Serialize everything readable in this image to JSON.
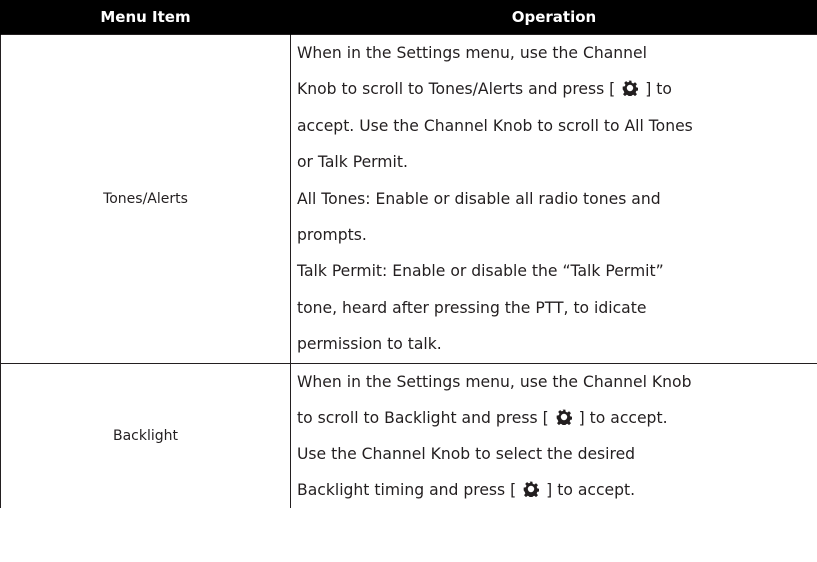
{
  "table": {
    "headers": [
      "Menu Item",
      "Operation"
    ],
    "rows": [
      {
        "item": "Tones/Alerts",
        "lines": [
          {
            "pre": "When in the Settings menu, use the Channel"
          },
          {
            "pre": "Knob to scroll to Tones/Alerts and press [",
            "icon": "gear-icon",
            "post": "] to"
          },
          {
            "pre": "accept. Use the Channel Knob to scroll to All Tones"
          },
          {
            "pre": "or Talk Permit."
          },
          {
            "pre": "All Tones: Enable or disable all radio tones and"
          },
          {
            "pre": "prompts."
          },
          {
            "pre": "Talk Permit: Enable or disable the “Talk Permit”"
          },
          {
            "pre": "tone, heard after pressing the PTT, to idicate"
          },
          {
            "pre": "permission to talk."
          }
        ]
      },
      {
        "item": "Backlight",
        "lines": [
          {
            "pre": "When in the Settings menu, use the Channel Knob"
          },
          {
            "pre": "to scroll to Backlight and press [",
            "icon": "gear-icon",
            "post": "] to accept."
          },
          {
            "pre": "Use the Channel Knob to select the desired"
          },
          {
            "pre": "Backlight timing and press [",
            "icon": "gear-icon",
            "post": "] to accept."
          }
        ]
      }
    ]
  }
}
